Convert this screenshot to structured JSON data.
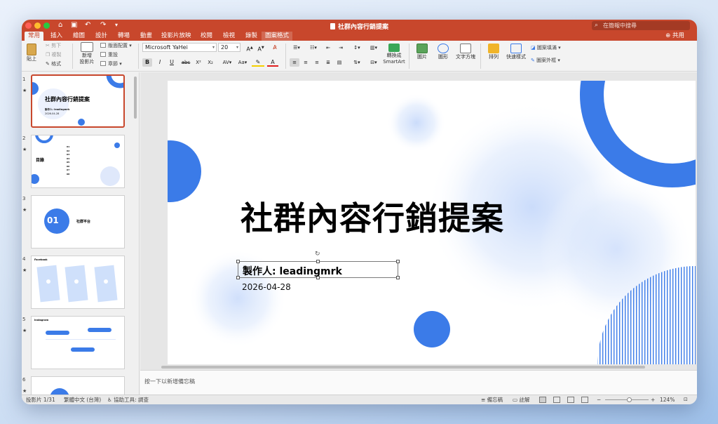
{
  "window": {
    "title": "社群內容行銷提案",
    "search_placeholder": "在簡報中搜尋"
  },
  "tabs": [
    "常用",
    "插入",
    "繪圖",
    "設計",
    "轉場",
    "動畫",
    "投影片放映",
    "校閱",
    "檢視",
    "錄製",
    "圖案格式"
  ],
  "share_label": "共用",
  "ribbon": {
    "paste": "貼上",
    "cut": "剪下",
    "copy": "複製",
    "format_painter": "格式",
    "new_slide_line1": "新增",
    "new_slide_line2": "投影片",
    "layout": "版面配置",
    "reset": "重設",
    "section": "章節",
    "font_name": "Microsoft YaHei",
    "font_size": "20",
    "convert_smartart_line1": "轉換成",
    "convert_smartart_line2": "SmartArt",
    "picture": "圖片",
    "shapes": "圖形",
    "textbox": "文字方塊",
    "arrange": "排列",
    "quick_styles": "快速樣式",
    "shape_fill": "圖案填滿",
    "shape_outline": "圖案外框",
    "bold": "B",
    "italic": "I",
    "underline": "U",
    "strikethrough": "abc",
    "superscript": "X²",
    "subscript": "X₂"
  },
  "slides": {
    "numbers": [
      "1",
      "2",
      "3",
      "4",
      "5",
      "6"
    ],
    "thumb1_title": "社群內容行銷提案",
    "thumb1_author": "製作人: leadingmrk",
    "thumb1_date": "2026-04-28",
    "thumb2_title": "目錄",
    "thumb2_items": [
      "01",
      "02",
      "03",
      "04",
      "05",
      "06",
      "07",
      "08"
    ],
    "thumb3_number": "01",
    "thumb3_title": "社群平台",
    "thumb4_title": "Facebook",
    "thumb5_title": "Instagram"
  },
  "slide": {
    "title": "社群內容行銷提案",
    "author": "製作人: leadingmrk",
    "date": "2026-04-28",
    "accent_color": "#3b7be8"
  },
  "notes_placeholder": "按一下以新增備忘稿",
  "status": {
    "slide_counter": "投影片 1/31",
    "language": "繁體中文 (台灣)",
    "accessibility": "協助工具: 調查",
    "notes": "備忘稿",
    "comments": "註解",
    "zoom": "124%",
    "zoom_fraction": 0.55
  }
}
